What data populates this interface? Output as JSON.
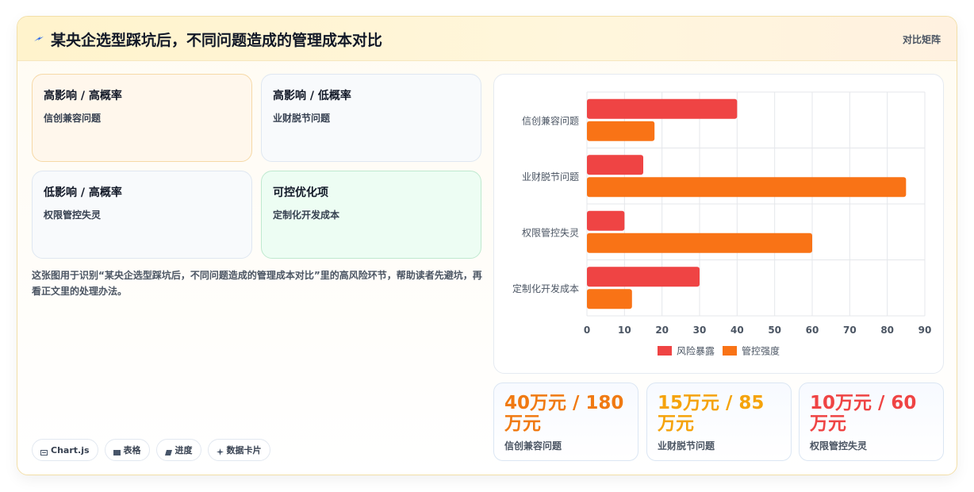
{
  "header": {
    "title": "某央企选型踩坑后，不同问题造成的管理成本对比",
    "tag": "对比矩阵"
  },
  "quadrants": [
    {
      "title": "高影响 / 高概率",
      "item": "信创兼容问题"
    },
    {
      "title": "高影响 / 低概率",
      "item": "业财脱节问题"
    },
    {
      "title": "低影响 / 高概率",
      "item": "权限管控失灵"
    },
    {
      "title": "可控优化项",
      "item": "定制化开发成本"
    }
  ],
  "description": "这张图用于识别“某央企选型踩坑后，不同问题造成的管理成本对比”里的高风险环节，帮助读者先避坑，再看正文里的处理办法。",
  "pills": [
    "Chart.js",
    "表格",
    "进度",
    "数据卡片"
  ],
  "stats": [
    {
      "value": "40万元 / 180万元",
      "label": "信创兼容问题",
      "color": "#f07a12"
    },
    {
      "value": "15万元 / 85万元",
      "label": "业财脱节问题",
      "color": "#f5a30b"
    },
    {
      "value": "10万元 / 60万元",
      "label": "权限管控失灵",
      "color": "#ef4444"
    }
  ],
  "chart_data": {
    "type": "bar",
    "orientation": "horizontal",
    "categories": [
      "信创兼容问题",
      "业财脱节问题",
      "权限管控失灵",
      "定制化开发成本"
    ],
    "series": [
      {
        "name": "风险暴露",
        "values": [
          40,
          15,
          10,
          30
        ],
        "color": "#ef4444"
      },
      {
        "name": "管控强度",
        "values": [
          18,
          85,
          60,
          12
        ],
        "color": "#f97316"
      }
    ],
    "xlim": [
      0,
      90
    ],
    "xticks": [
      0,
      10,
      20,
      30,
      40,
      50,
      60,
      70,
      80,
      90
    ],
    "grid": true,
    "legend": "bottom"
  }
}
